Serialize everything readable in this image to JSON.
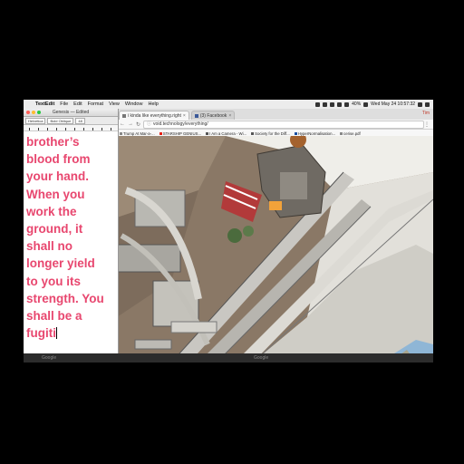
{
  "menubar": {
    "app": "TextEdit",
    "items": [
      "File",
      "Edit",
      "Format",
      "View",
      "Window",
      "Help"
    ],
    "date_time": "Wed May 24  10:57:32",
    "battery": "40%"
  },
  "textedit": {
    "title": "Genesis — Edited",
    "font_name": "Helvetica",
    "font_style": "Bold Oblique",
    "font_size": "48",
    "lines": [
      "brother’s",
      "blood from",
      "your hand.",
      "When you",
      "work the",
      "ground, it",
      "shall no",
      "longer yield",
      "to you its",
      "strength. You",
      "shall be a",
      "fugiti"
    ],
    "text_color": "#e8476f"
  },
  "chrome": {
    "tabs": [
      {
        "label": "i kinda like everything.right",
        "active": true
      },
      {
        "label": "(3) Facebook",
        "active": false
      }
    ],
    "user": "Tim",
    "url": "void.technology/everything/",
    "bookmarks": [
      {
        "label": "Trump At Mar-a-...",
        "icon": "bookmark-icon"
      },
      {
        "label": "STARSHIP GENIUS...",
        "icon": "youtube-icon"
      },
      {
        "label": "I Am a Camera - Wi...",
        "icon": "wikipedia-icon"
      },
      {
        "label": "Society for the Diff...",
        "icon": "wikipedia-icon"
      },
      {
        "label": "HyperNormalisation...",
        "icon": "doc-icon"
      },
      {
        "label": "cerise.pdf",
        "icon": "pdf-icon"
      }
    ]
  },
  "bottom": {
    "left": "Google",
    "right": "Google"
  },
  "colors": {
    "text_pink": "#e8476f",
    "scene_floor": "#8a7a6a",
    "scene_wall": "#e8e6e0"
  }
}
